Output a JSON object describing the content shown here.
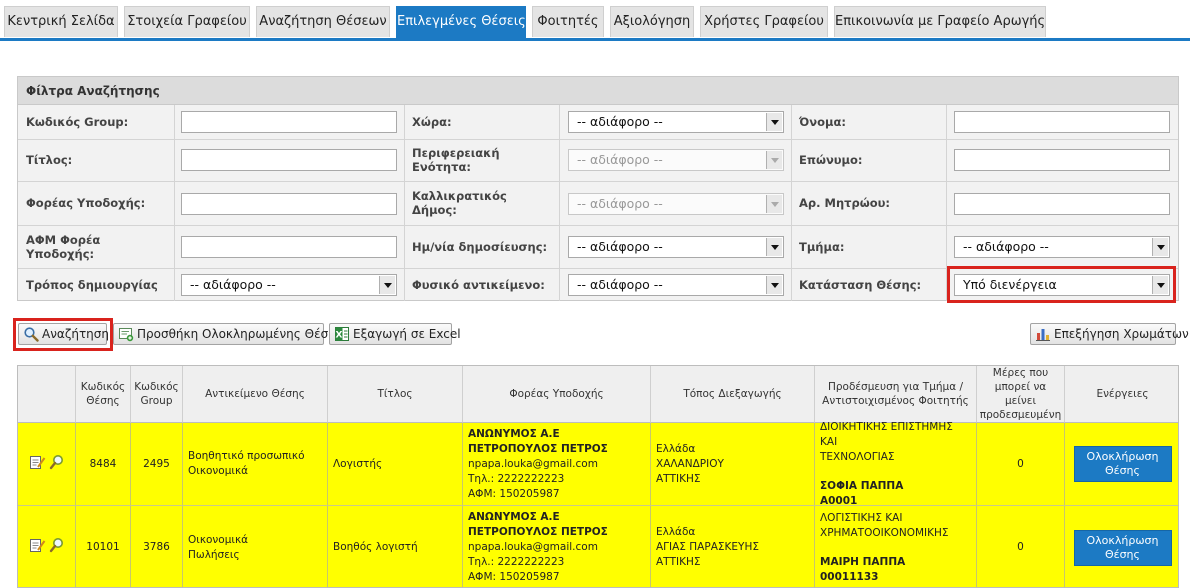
{
  "tabs": [
    {
      "label": "Κεντρική Σελίδα"
    },
    {
      "label": "Στοιχεία Γραφείου"
    },
    {
      "label": "Αναζήτηση Θέσεων"
    },
    {
      "label": "Επιλεγμένες Θέσεις"
    },
    {
      "label": "Φοιτητές"
    },
    {
      "label": "Αξιολόγηση"
    },
    {
      "label": "Χρήστες Γραφείου"
    },
    {
      "label": "Επικοινωνία με Γραφείο Αρωγής"
    }
  ],
  "active_tab": "Επιλεγμένες Θέσεις",
  "filters": {
    "title": "Φίλτρα Αναζήτησης",
    "group_code": {
      "label": "Κωδικός Group:",
      "value": ""
    },
    "title_field": {
      "label": "Τίτλος:",
      "value": ""
    },
    "host": {
      "label": "Φορέας Υποδοχής:",
      "value": ""
    },
    "host_afm": {
      "label": "ΑΦΜ Φορέα Υποδοχής:",
      "value": ""
    },
    "creation_mode": {
      "label": "Τρόπος δημιουργίας",
      "value": "-- αδιάφορο --"
    },
    "country": {
      "label": "Χώρα:",
      "value": "-- αδιάφορο --"
    },
    "region": {
      "label": "Περιφερειακή Ενότητα:",
      "value": "-- αδιάφορο --"
    },
    "municipality": {
      "label": "Καλλικρατικός Δήμος:",
      "value": "-- αδιάφορο --"
    },
    "pub_date": {
      "label": "Ημ/νία δημοσίευσης:",
      "value": "-- αδιάφορο --"
    },
    "physical_object": {
      "label": "Φυσικό αντικείμενο:",
      "value": "-- αδιάφορο --"
    },
    "first_name": {
      "label": "Όνομα:",
      "value": ""
    },
    "last_name": {
      "label": "Επώνυμο:",
      "value": ""
    },
    "reg_number": {
      "label": "Αρ. Μητρώου:",
      "value": ""
    },
    "department": {
      "label": "Τμήμα:",
      "value": "-- αδιάφορο --"
    },
    "position_status": {
      "label": "Κατάσταση Θέσης:",
      "value": "Υπό διενέργεια"
    }
  },
  "toolbar": {
    "search": "Αναζήτηση",
    "add_completed": "Προσθήκη Ολοκληρωμένης Θέσης",
    "export_excel": "Εξαγωγή σε Excel",
    "color_legend": "Επεξήγηση Χρωμάτων"
  },
  "table": {
    "headers": {
      "code": "Κωδικός Θέσης",
      "group": "Κωδικός Group",
      "object": "Αντικείμενο Θέσης",
      "title": "Τίτλος",
      "host": "Φορέας Υποδοχής",
      "place": "Τόπος Διεξαγωγής",
      "reserved": "Προδέσμευση για Τμήμα / Αντιστοιχισμένος Φοιτητής",
      "days": "Μέρες που μπορεί να μείνει προδεσμευμένη",
      "actions": "Ενέργειες"
    },
    "rows": [
      {
        "code": "8484",
        "group": "2495",
        "object_1": "Βοηθητικό προσωπικό",
        "object_2": "Οικονομικά",
        "title": "Λογιστής",
        "host_name_1": "ΑΝΩΝΥΜΟΣ Α.Ε",
        "host_name_2": "ΠΕΤΡΟΠΟΥΛΟΣ ΠΕΤΡΟΣ",
        "host_email": "npapa.louka@gmail.com",
        "host_phone": "Τηλ.: 2222222223",
        "host_afm": "ΑΦΜ: 150205987",
        "place_1": "Ελλάδα",
        "place_2": "ΧΑΛΑΝΔΡΙΟΥ",
        "place_3": "ΑΤΤΙΚΗΣ",
        "dept_1": "ΔΙΟΙΚΗΤΙΚΗΣ ΕΠΙΣΤΗΜΗΣ ΚΑΙ",
        "dept_2": "ΤΕΧΝΟΛΟΓΙΑΣ",
        "student": "ΣΟΦΙΑ ΠΑΠΠΑ",
        "student_id": "A0001",
        "days": "0",
        "action_1": "Ολοκλήρωση",
        "action_2": "Θέσης"
      },
      {
        "code": "10101",
        "group": "3786",
        "object_1": "Οικονομικά",
        "object_2": "Πωλήσεις",
        "title": "Βοηθός λογιστή",
        "host_name_1": "ΑΝΩΝΥΜΟΣ Α.Ε",
        "host_name_2": "ΠΕΤΡΟΠΟΥΛΟΣ ΠΕΤΡΟΣ",
        "host_email": "npapa.louka@gmail.com",
        "host_phone": "Τηλ.: 2222222223",
        "host_afm": "ΑΦΜ: 150205987",
        "place_1": "Ελλάδα",
        "place_2": "ΑΓΙΑΣ ΠΑΡΑΣΚΕΥΗΣ",
        "place_3": "ΑΤΤΙΚΗΣ",
        "dept_1": "ΛΟΓΙΣΤΙΚΗΣ ΚΑΙ",
        "dept_2": "ΧΡΗΜΑΤΟΟΙΚΟΝΟΜΙΚΗΣ",
        "student": "ΜΑΙΡΗ ΠΑΠΠΑ",
        "student_id": "00011133",
        "days": "0",
        "action_1": "Ολοκλήρωση",
        "action_2": "Θέσης"
      }
    ]
  },
  "colors": {
    "accent": "#1c7ac4",
    "row_highlight": "#ffff00",
    "highlight_border": "#d9231d"
  }
}
